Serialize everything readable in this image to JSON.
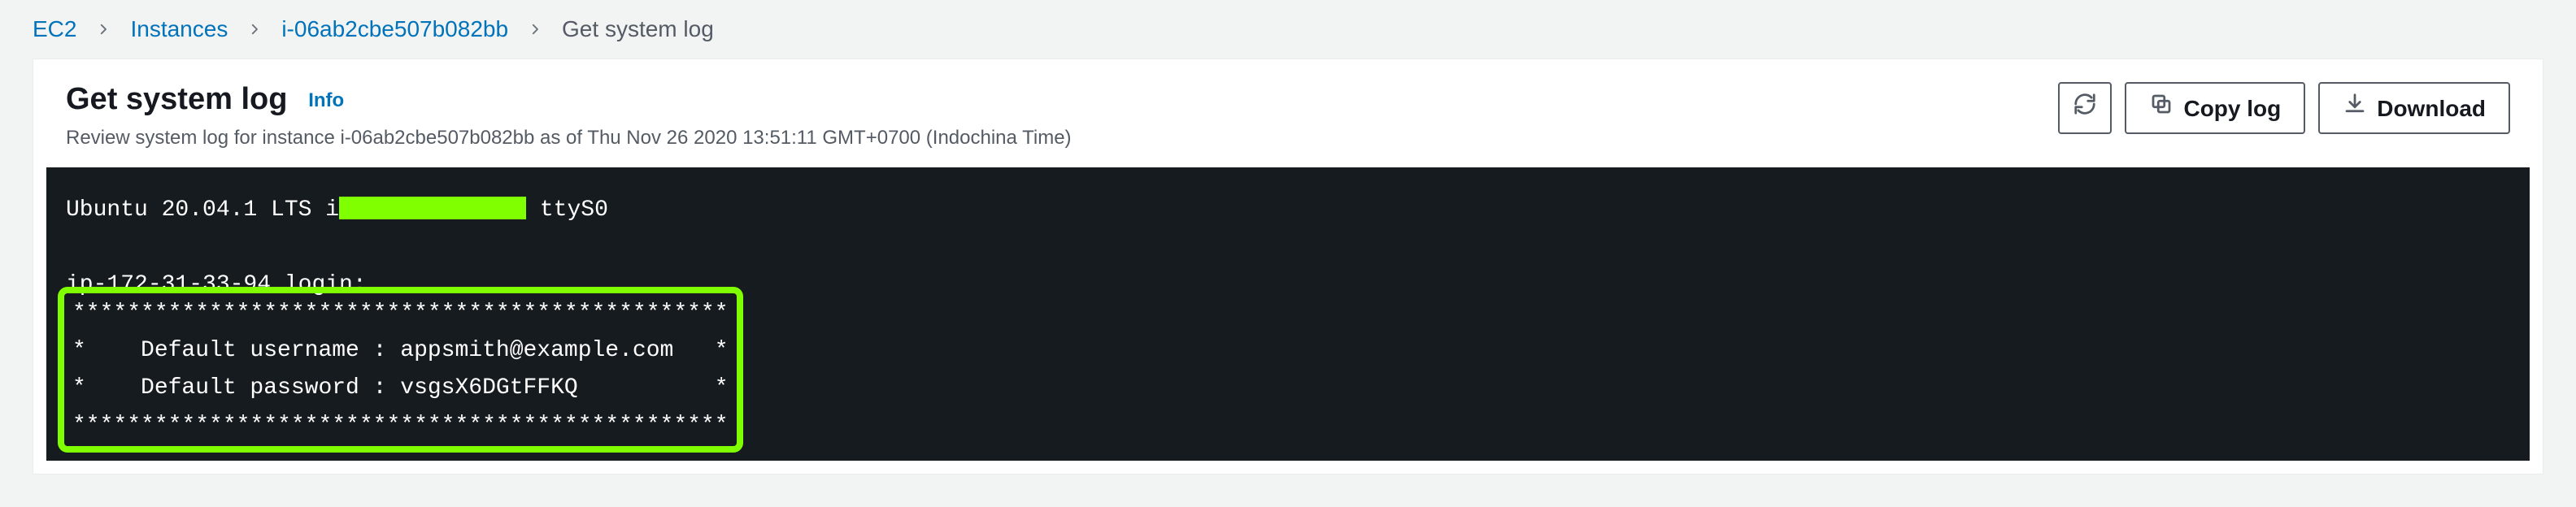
{
  "breadcrumb": {
    "items": [
      {
        "label": "EC2"
      },
      {
        "label": "Instances"
      },
      {
        "label": "i-06ab2cbe507b082bb"
      }
    ],
    "current": "Get system log"
  },
  "header": {
    "title": "Get system log",
    "info_label": "Info",
    "subtitle": "Review system log for instance i-06ab2cbe507b082bb as of Thu Nov 26 2020 13:51:11 GMT+0700 (Indochina Time)"
  },
  "actions": {
    "refresh_aria": "Refresh",
    "copy_label": "Copy log",
    "download_label": "Download"
  },
  "terminal": {
    "line1_pre": "Ubuntu 20.04.1 LTS i",
    "line1_post": " ttyS0",
    "line2": "ip-172-31-33-94 login:",
    "box_border": "************************************************",
    "box_user": "*    Default username : appsmith@example.com   *",
    "box_pass": "*    Default password : vsgsX6DGtFFKQ          *"
  }
}
